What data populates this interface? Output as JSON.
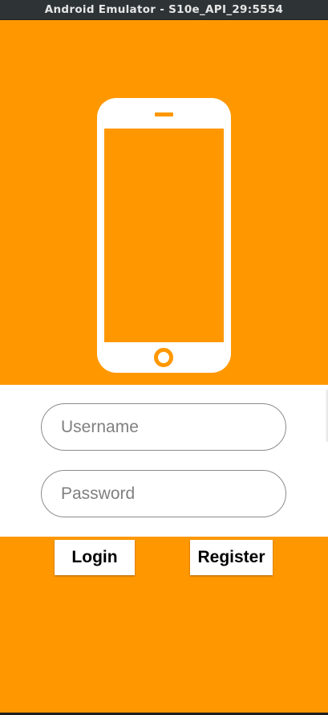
{
  "window": {
    "title": "Android Emulator - S10e_API_29:5554"
  },
  "colors": {
    "accent": "#ff9800",
    "panel": "#ffffff",
    "titlebar": "#2e3436"
  },
  "hero": {
    "icon": "smartphone-icon"
  },
  "form": {
    "username": {
      "placeholder": "Username",
      "value": ""
    },
    "password": {
      "placeholder": "Password",
      "value": ""
    }
  },
  "actions": {
    "login_label": "Login",
    "register_label": "Register"
  }
}
